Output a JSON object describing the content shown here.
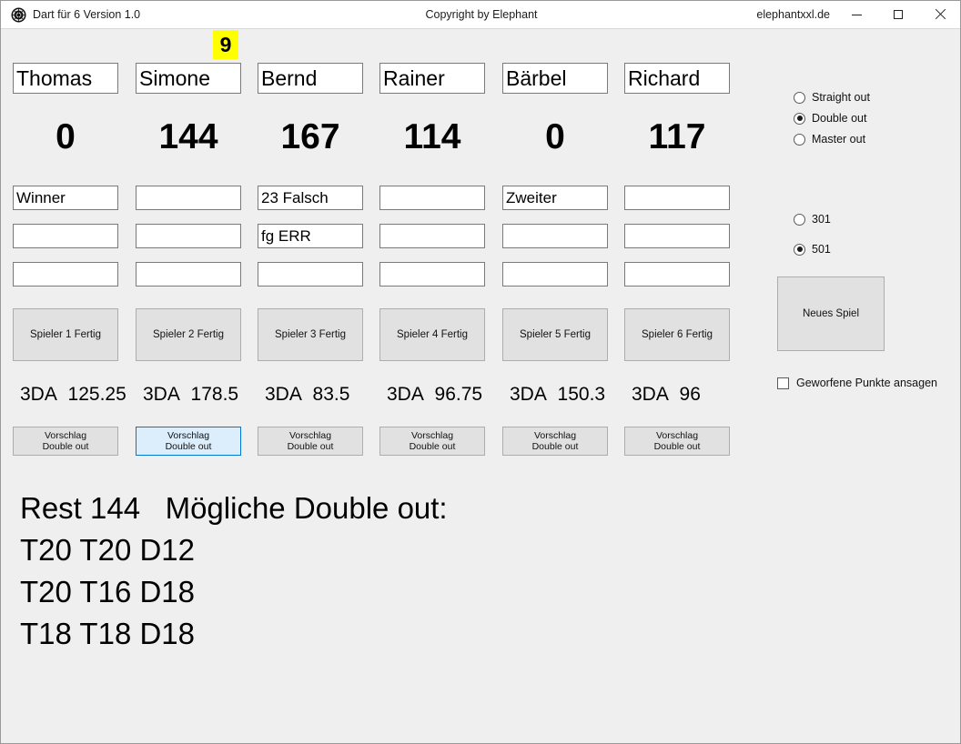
{
  "window": {
    "icon": "dartboard-icon",
    "title": "Dart für 6  Version 1.0",
    "center_title": "Copyright by Elephant",
    "right_title": "elephantxxl.de",
    "minimize_label": "–",
    "maximize_label": "□",
    "close_label": "✕"
  },
  "turn": {
    "badge_value": "9",
    "active_player_index": 1
  },
  "players": [
    {
      "name": "Thomas",
      "score": "0",
      "throws": [
        "Winner",
        "",
        ""
      ],
      "fertig_label": "Spieler 1 Fertig",
      "threeda_label": "3DA",
      "threeda_value": "125.25",
      "vorschlag_line1": "Vorschlag",
      "vorschlag_line2": "Double out",
      "focused": false
    },
    {
      "name": "Simone",
      "score": "144",
      "throws": [
        "",
        "",
        ""
      ],
      "fertig_label": "Spieler 2 Fertig",
      "threeda_label": "3DA",
      "threeda_value": "178.5",
      "vorschlag_line1": "Vorschlag",
      "vorschlag_line2": "Double out",
      "focused": true
    },
    {
      "name": "Bernd",
      "score": "167",
      "throws": [
        "23 Falsch",
        "fg ERR",
        ""
      ],
      "fertig_label": "Spieler 3 Fertig",
      "threeda_label": "3DA",
      "threeda_value": "83.5",
      "vorschlag_line1": "Vorschlag",
      "vorschlag_line2": "Double out",
      "focused": false
    },
    {
      "name": "Rainer",
      "score": "114",
      "throws": [
        "",
        "",
        ""
      ],
      "fertig_label": "Spieler 4 Fertig",
      "threeda_label": "3DA",
      "threeda_value": "96.75",
      "vorschlag_line1": "Vorschlag",
      "vorschlag_line2": "Double out",
      "focused": false
    },
    {
      "name": "Bärbel",
      "score": "0",
      "throws": [
        "Zweiter",
        "",
        ""
      ],
      "fertig_label": "Spieler 5 Fertig",
      "threeda_label": "3DA",
      "threeda_value": "150.3",
      "vorschlag_line1": "Vorschlag",
      "vorschlag_line2": "Double out",
      "focused": false
    },
    {
      "name": "Richard",
      "score": "117",
      "throws": [
        "",
        "",
        ""
      ],
      "fertig_label": "Spieler 6 Fertig",
      "threeda_label": "3DA",
      "threeda_value": "96",
      "vorschlag_line1": "Vorschlag",
      "vorschlag_line2": "Double out",
      "focused": false
    }
  ],
  "options": {
    "out_modes": [
      {
        "label": "Straight out",
        "selected": false
      },
      {
        "label": "Double out",
        "selected": true
      },
      {
        "label": "Master out",
        "selected": false
      }
    ],
    "game_modes": [
      {
        "label": "301",
        "selected": false
      },
      {
        "label": "501",
        "selected": true
      }
    ],
    "new_game_label": "Neues Spiel",
    "announce_checkbox_label": "Geworfene Punkte ansagen",
    "announce_checked": false
  },
  "suggestion": {
    "header": "Rest 144   Mögliche Double out:",
    "lines": [
      "T20 T20 D12",
      "T20 T16 D18",
      "T18 T18 D18"
    ]
  },
  "colors": {
    "window_bg": "#efefef",
    "titlebar_bg": "#ffffff",
    "highlight_yellow": "#ffff00",
    "focus_blue": "#0078d7",
    "focus_fill": "#dcedfb",
    "button_face": "#e1e1e1"
  }
}
